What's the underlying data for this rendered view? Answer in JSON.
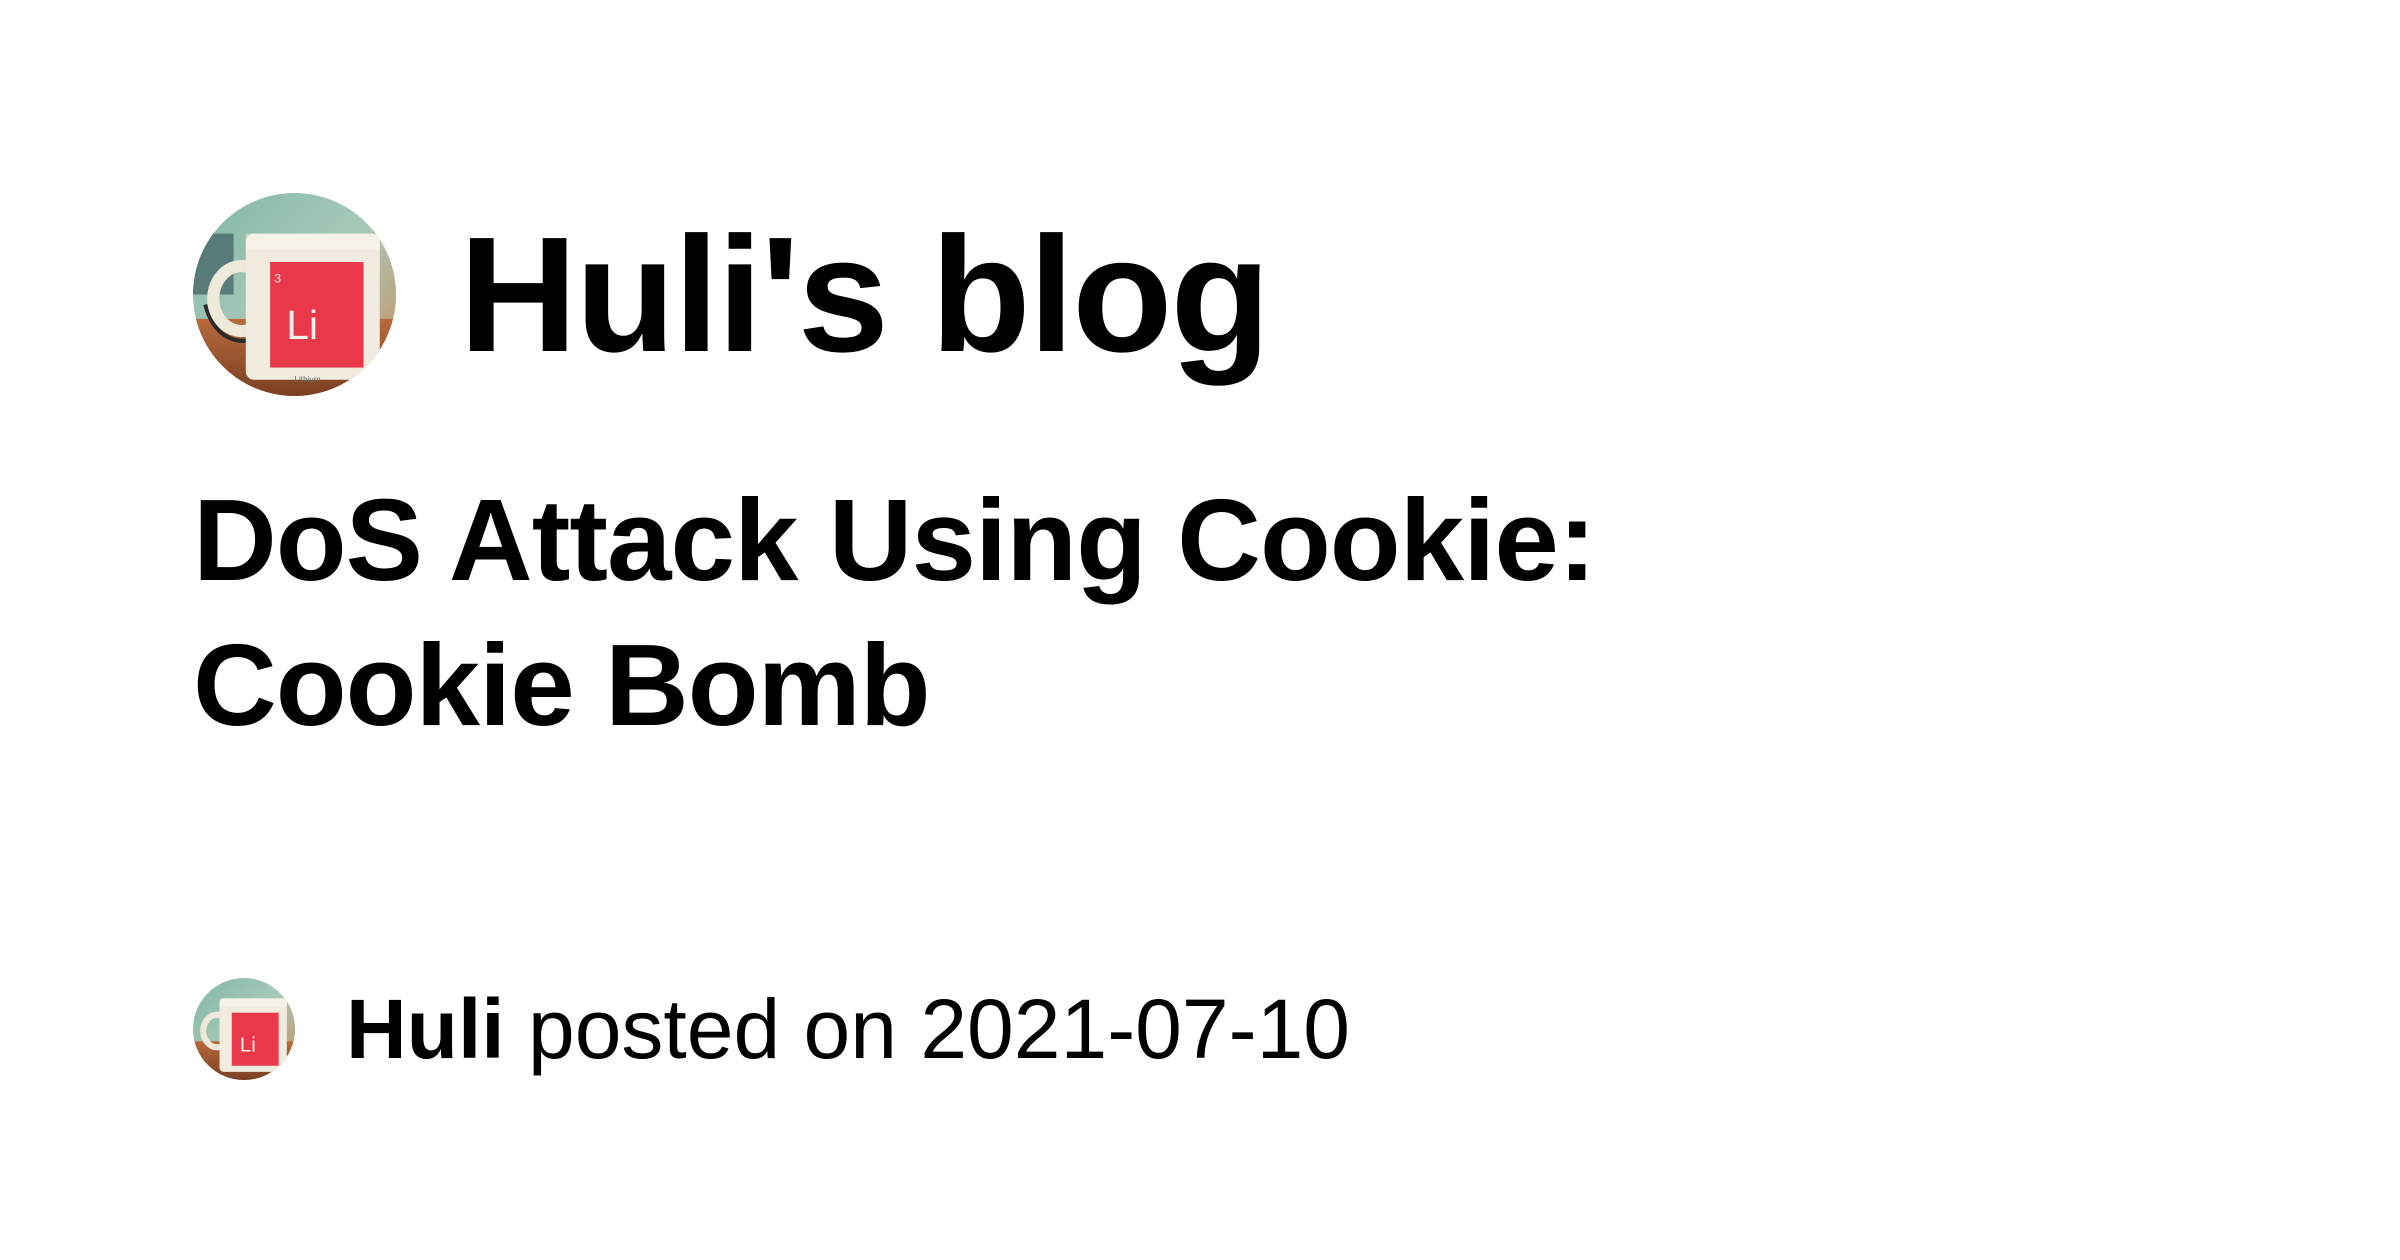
{
  "blog": {
    "title": "Huli's blog",
    "avatar_icon": "red-mug-avatar-icon",
    "avatar_mug_label": "Li"
  },
  "post": {
    "title_line1": "DoS Attack Using Cookie:",
    "title_line2": "Cookie Bomb",
    "author": "Huli",
    "posted_on_text": "posted on",
    "date": "2021-07-10"
  },
  "colors": {
    "background": "#ffffff",
    "text": "#000000",
    "mug_red": "#e8384a"
  }
}
